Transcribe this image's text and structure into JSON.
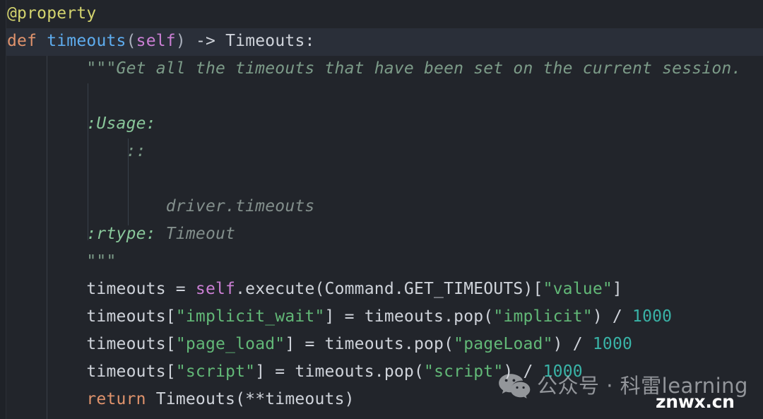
{
  "editor": {
    "background": "#22252b",
    "active_line_background": "#2a2f39",
    "gutter_background": "#1f2228",
    "colors": {
      "decorator": "#d3d36e",
      "keyword": "#e0936c",
      "function": "#5eacee",
      "self": "#cb7fd4",
      "punctuation": "#a9afbb",
      "plain": "#cfd3da",
      "string": "#62b877",
      "number": "#39b3a7",
      "docstring": "#7c9b88",
      "docstring_key": "#89c79a"
    },
    "language": "python"
  },
  "code": {
    "lines": [
      {
        "id": "line-decorator",
        "tokens": [
          {
            "text": "@property",
            "type": "decorator"
          }
        ]
      },
      {
        "id": "line-def",
        "active": true,
        "tokens": [
          {
            "text": "def ",
            "type": "keyword"
          },
          {
            "text": "timeouts",
            "type": "function"
          },
          {
            "text": "(",
            "type": "punct"
          },
          {
            "text": "self",
            "type": "self"
          },
          {
            "text": ")",
            "type": "punct"
          },
          {
            "text": " -> Timeouts:",
            "type": "plain"
          }
        ]
      },
      {
        "id": "line-doc-open",
        "tokens": [
          {
            "text": "        \"\"\"Get all the timeouts that have been set on the current session.",
            "type": "doc"
          }
        ]
      },
      {
        "id": "line-blank-1",
        "tokens": [
          {
            "text": " ",
            "type": "doc"
          }
        ]
      },
      {
        "id": "line-doc-usage",
        "tokens": [
          {
            "text": "        :Usage:",
            "type": "doc-key"
          }
        ]
      },
      {
        "id": "line-doc-colons",
        "tokens": [
          {
            "text": "            ::",
            "type": "doc"
          }
        ]
      },
      {
        "id": "line-blank-2",
        "tokens": [
          {
            "text": " ",
            "type": "doc"
          }
        ]
      },
      {
        "id": "line-doc-example",
        "tokens": [
          {
            "text": "                driver.timeouts",
            "type": "doc-dim"
          }
        ]
      },
      {
        "id": "line-doc-rtype",
        "tokens": [
          {
            "text": "        :rtype:",
            "type": "doc-key"
          },
          {
            "text": " Timeout",
            "type": "doc-dim"
          }
        ]
      },
      {
        "id": "line-doc-close",
        "tokens": [
          {
            "text": "        \"\"\"",
            "type": "doc"
          }
        ]
      },
      {
        "id": "line-exec",
        "tokens": [
          {
            "text": "        timeouts = ",
            "type": "plain"
          },
          {
            "text": "self",
            "type": "self"
          },
          {
            "text": ".execute(Command.GET_TIMEOUTS)[",
            "type": "plain"
          },
          {
            "text": "\"value\"",
            "type": "string"
          },
          {
            "text": "]",
            "type": "plain"
          }
        ]
      },
      {
        "id": "line-implicit",
        "tokens": [
          {
            "text": "        timeouts[",
            "type": "plain"
          },
          {
            "text": "\"implicit_wait\"",
            "type": "string"
          },
          {
            "text": "] = timeouts.pop(",
            "type": "plain"
          },
          {
            "text": "\"implicit\"",
            "type": "string"
          },
          {
            "text": ") / ",
            "type": "plain"
          },
          {
            "text": "1000",
            "type": "number"
          }
        ]
      },
      {
        "id": "line-pageload",
        "tokens": [
          {
            "text": "        timeouts[",
            "type": "plain"
          },
          {
            "text": "\"page_load\"",
            "type": "string"
          },
          {
            "text": "] = timeouts.pop(",
            "type": "plain"
          },
          {
            "text": "\"pageLoad\"",
            "type": "string"
          },
          {
            "text": ") / ",
            "type": "plain"
          },
          {
            "text": "1000",
            "type": "number"
          }
        ]
      },
      {
        "id": "line-script",
        "tokens": [
          {
            "text": "        timeouts[",
            "type": "plain"
          },
          {
            "text": "\"script\"",
            "type": "string"
          },
          {
            "text": "] = timeouts.pop(",
            "type": "plain"
          },
          {
            "text": "\"script\"",
            "type": "string"
          },
          {
            "text": ") / ",
            "type": "plain"
          },
          {
            "text": "1000",
            "type": "number"
          }
        ]
      },
      {
        "id": "line-return",
        "tokens": [
          {
            "text": "        return",
            "type": "keyword"
          },
          {
            "text": " Timeouts(**timeouts)",
            "type": "plain"
          }
        ]
      }
    ]
  },
  "watermark": {
    "icon": "wechat-icon",
    "text": "公众号 · 科雷learning",
    "site": "znwx.cn"
  }
}
